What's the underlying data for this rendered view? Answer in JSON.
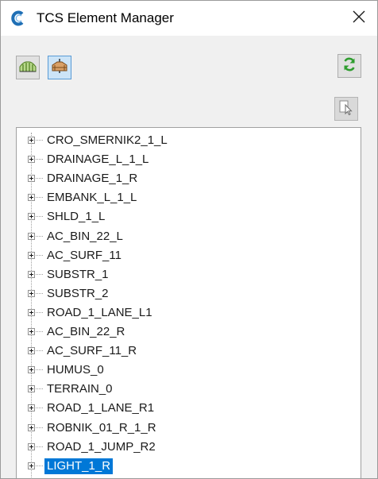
{
  "window": {
    "title": "TCS Element Manager"
  },
  "icons": {
    "app": "tcs-app-icon",
    "close": "close-icon",
    "profile": "longitudinal-profile-icon",
    "cross_section": "cross-section-icon",
    "refresh": "refresh-icon",
    "select": "select-element-icon"
  },
  "colors": {
    "selection": "#0078d7",
    "refresh_green": "#2e9d2e",
    "app_blue": "#1f6fb5"
  },
  "tree": {
    "items": [
      "CRO_SMERNIK2_1_L",
      "DRAINAGE_L_1_L",
      "DRAINAGE_1_R",
      "EMBANK_L_1_L",
      "SHLD_1_L",
      "AC_BIN_22_L",
      "AC_SURF_11",
      "SUBSTR_1",
      "SUBSTR_2",
      "ROAD_1_LANE_L1",
      "AC_BIN_22_R",
      "AC_SURF_11_R",
      "HUMUS_0",
      "TERRAIN_0",
      "ROAD_1_LANE_R1",
      "ROBNIK_01_R_1_R",
      "ROAD_1_JUMP_R2",
      "LIGHT_1_R"
    ],
    "selected_item": "LIGHT_1_R"
  }
}
